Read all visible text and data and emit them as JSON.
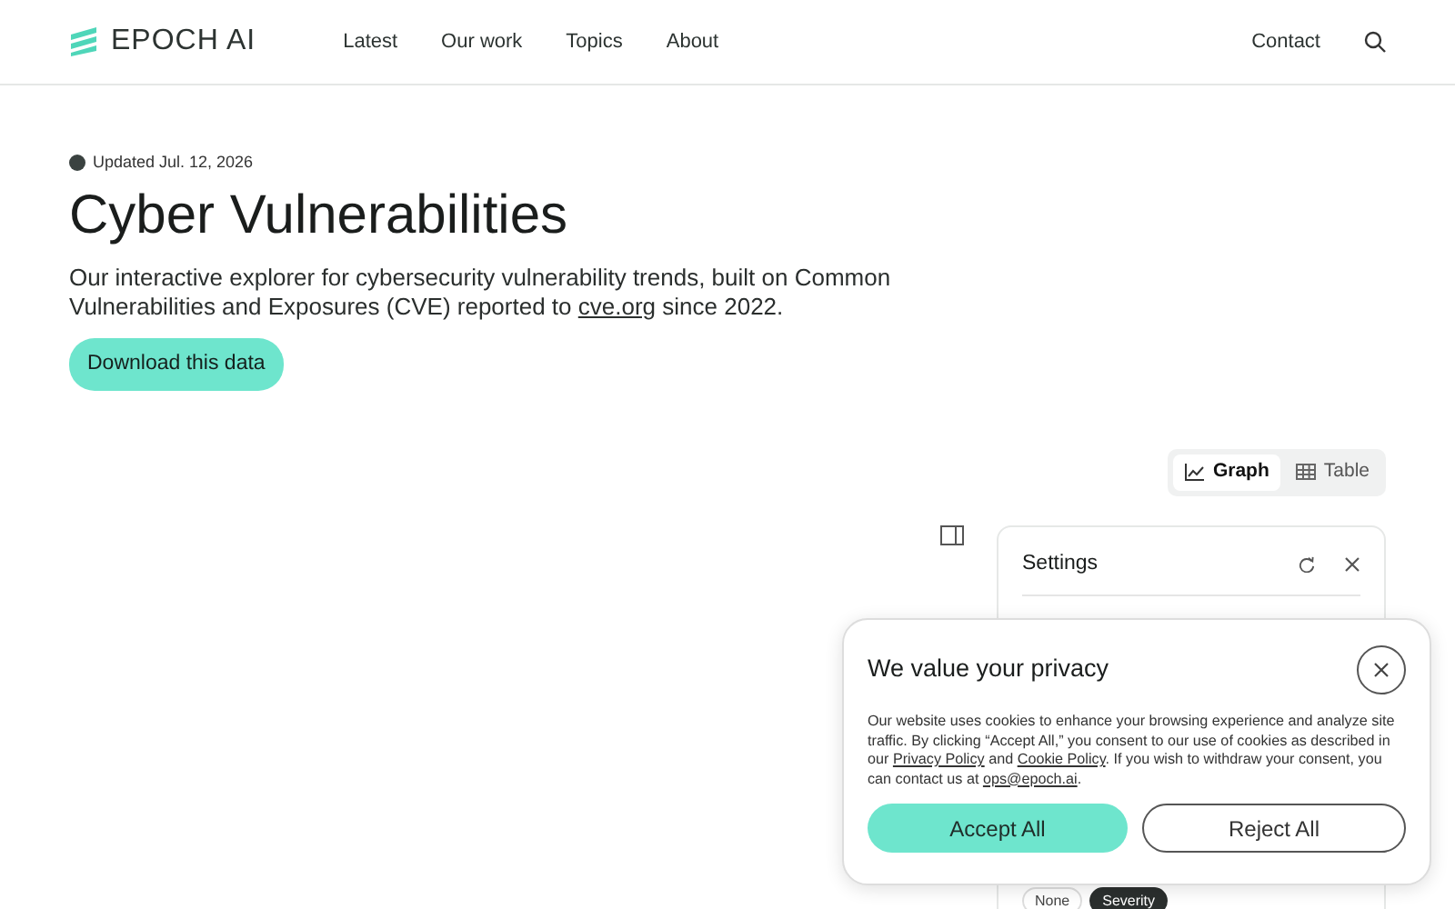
{
  "nav": {
    "logo": "EPOCH AI",
    "links": [
      "Latest",
      "Our work",
      "Topics",
      "About"
    ],
    "contact": "Contact"
  },
  "updated": "Updated Jul. 12, 2026",
  "title": "Cyber Vulnerabilities",
  "description": [
    {
      "text": "Our interactive explorer for cybersecurity vulnerability trends, built on Common Vulnerabilities and Exposures (CVE) reported to "
    },
    {
      "text": "cve.org",
      "kind": "link"
    },
    {
      "text": " since 2022."
    }
  ],
  "download_button": "Download this data",
  "view_tabs": [
    {
      "label": "Graph",
      "selected": true
    },
    {
      "label": "Table",
      "selected": false
    }
  ],
  "settings": {
    "title": "Settings",
    "chips": [
      {
        "label": "None",
        "selected": false
      },
      {
        "label": "Severity",
        "selected": true
      }
    ]
  },
  "cookie_banner": {
    "title": "We value your privacy",
    "text": [
      {
        "text": "Our website uses cookies to enhance your browsing experience and analyze site traffic. By clicking “Accept All,” you consent to our use of cookies as described in our "
      },
      {
        "text": "Privacy Policy",
        "kind": "link"
      },
      {
        "text": " and "
      },
      {
        "text": "Cookie Policy",
        "kind": "link"
      },
      {
        "text": ". If you wish to withdraw your consent, you can contact us at "
      },
      {
        "text": "ops@epoch.ai",
        "kind": "link"
      },
      {
        "text": "."
      }
    ],
    "accept": "Accept All",
    "reject": "Reject All"
  }
}
